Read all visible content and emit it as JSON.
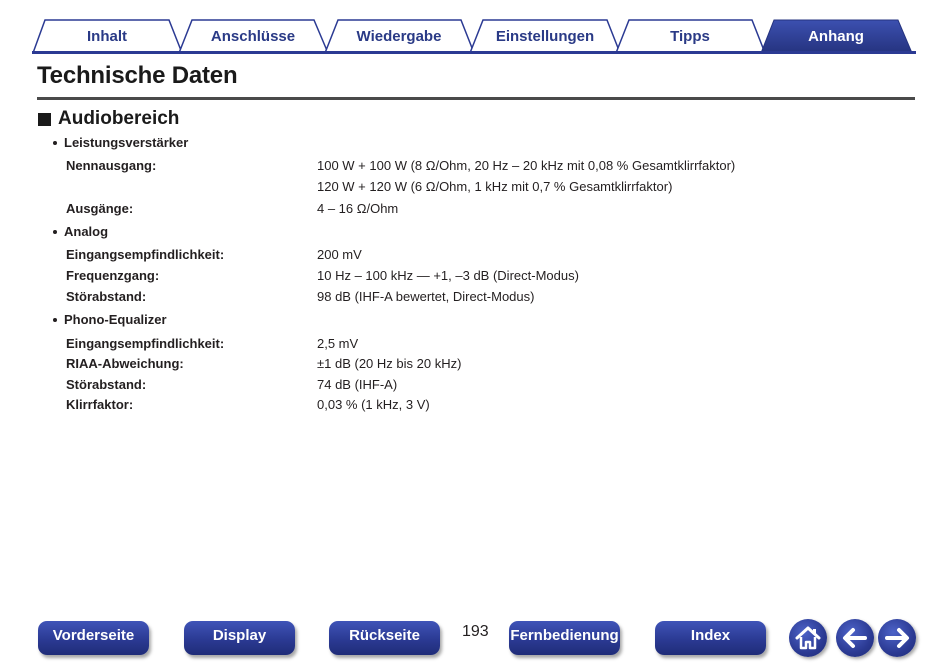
{
  "tabs": [
    {
      "label": "Inhalt",
      "active": false
    },
    {
      "label": "Anschlüsse",
      "active": false
    },
    {
      "label": "Wiedergabe",
      "active": false
    },
    {
      "label": "Einstellungen",
      "active": false
    },
    {
      "label": "Tipps",
      "active": false
    },
    {
      "label": "Anhang",
      "active": true
    }
  ],
  "page_title": "Technische Daten",
  "section": {
    "title": "Audiobereich",
    "groups": [
      {
        "heading": "Leistungsverstärker",
        "rows": [
          {
            "label": "Nennausgang:",
            "values": [
              "100 W + 100 W (8 Ω/Ohm, 20 Hz – 20 kHz mit 0,08 % Gesamtklirrfaktor)",
              "120 W + 120 W (6 Ω/Ohm, 1 kHz mit 0,7 % Gesamtklirrfaktor)"
            ]
          },
          {
            "label": "Ausgänge:",
            "values": [
              "4 – 16 Ω/Ohm"
            ]
          }
        ]
      },
      {
        "heading": "Analog",
        "rows": [
          {
            "label": "Eingangsempfindlichkeit:",
            "values": [
              "200 mV"
            ]
          },
          {
            "label": "Frequenzgang:",
            "values": [
              "10 Hz – 100 kHz — +1, –3 dB (Direct-Modus)"
            ]
          },
          {
            "label": "Störabstand:",
            "values": [
              "98 dB (IHF-A bewertet, Direct-Modus)"
            ]
          }
        ]
      },
      {
        "heading": "Phono-Equalizer",
        "rows": [
          {
            "label": "Eingangsempfindlichkeit:",
            "values": [
              "2,5 mV"
            ]
          },
          {
            "label": "RIAA-Abweichung:",
            "values": [
              "±1 dB (20 Hz bis 20 kHz)"
            ]
          },
          {
            "label": "Störabstand:",
            "values": [
              "74 dB (IHF-A)"
            ]
          },
          {
            "label": "Klirrfaktor:",
            "values": [
              "0,03 % (1 kHz, 3 V)"
            ]
          }
        ]
      }
    ]
  },
  "bottom_nav": {
    "front_page": "Vorderseite",
    "display": "Display",
    "rear_panel": "Rückseite",
    "page_number": "193",
    "remote": "Fernbedienung",
    "index": "Index",
    "icons": [
      "home-icon",
      "back-arrow-icon",
      "forward-arrow-icon"
    ]
  },
  "colors": {
    "accent": "#2b3a93",
    "tab_text": "#2a3a86",
    "text": "#231f20"
  }
}
